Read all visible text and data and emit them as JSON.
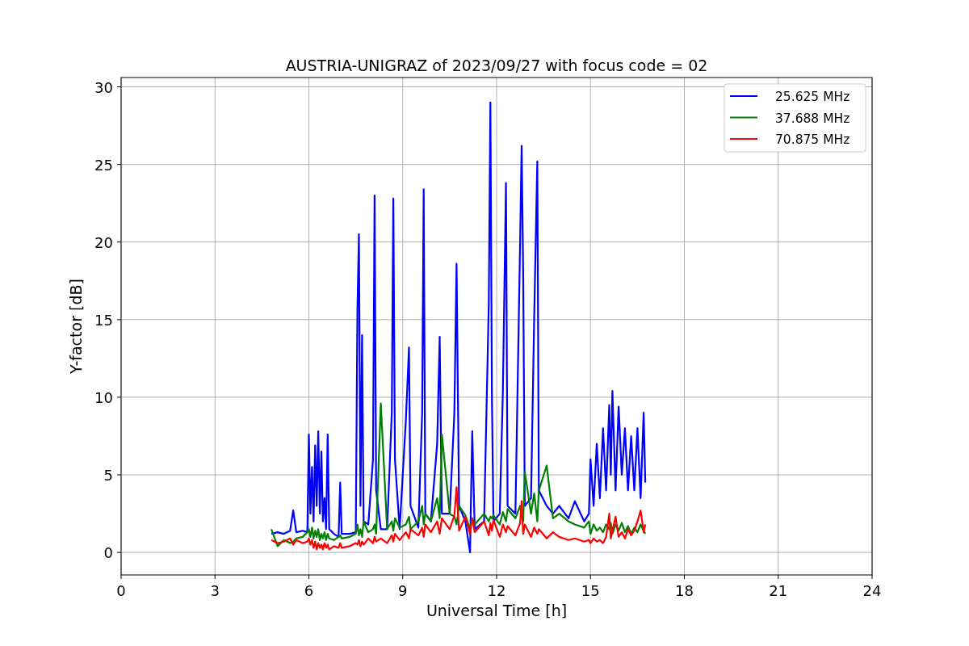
{
  "chart_data": {
    "type": "line",
    "title": "AUSTRIA-UNIGRAZ of 2023/09/27 with focus code = 02",
    "xlabel": "Universal Time [h]",
    "ylabel": "Y-factor [dB]",
    "xlim": [
      0,
      24
    ],
    "ylim": [
      -1.45,
      30.6
    ],
    "grid": true,
    "legend": "upper right",
    "xticks": [
      0,
      3,
      6,
      9,
      12,
      15,
      18,
      21,
      24
    ],
    "yticks": [
      0,
      5,
      10,
      15,
      20,
      25,
      30
    ],
    "x": [
      4.8,
      5.0,
      5.2,
      5.4,
      5.5,
      5.6,
      5.8,
      5.95,
      6.0,
      6.05,
      6.1,
      6.15,
      6.2,
      6.25,
      6.3,
      6.35,
      6.4,
      6.45,
      6.5,
      6.55,
      6.6,
      6.65,
      6.8,
      6.95,
      7.0,
      7.05,
      7.3,
      7.5,
      7.55,
      7.6,
      7.65,
      7.7,
      7.75,
      7.9,
      8.05,
      8.1,
      8.15,
      8.3,
      8.5,
      8.65,
      8.7,
      8.75,
      8.9,
      9.1,
      9.2,
      9.25,
      9.5,
      9.62,
      9.67,
      9.72,
      9.9,
      10.1,
      10.18,
      10.25,
      10.5,
      10.65,
      10.72,
      10.8,
      11.0,
      11.15,
      11.22,
      11.3,
      11.6,
      11.75,
      11.8,
      11.85,
      11.9,
      12.1,
      12.2,
      12.3,
      12.35,
      12.6,
      12.75,
      12.8,
      12.85,
      12.9,
      13.1,
      13.2,
      13.3,
      13.35,
      13.6,
      13.8,
      14.0,
      14.3,
      14.5,
      14.8,
      14.95,
      15.0,
      15.1,
      15.2,
      15.3,
      15.4,
      15.5,
      15.6,
      15.65,
      15.7,
      15.8,
      15.9,
      16.0,
      16.1,
      16.2,
      16.3,
      16.4,
      16.5,
      16.6,
      16.7,
      16.75
    ],
    "series": [
      {
        "name": "25.625 MHz",
        "color": "#0000ff",
        "values": [
          1.2,
          1.3,
          1.2,
          1.4,
          2.7,
          1.3,
          1.4,
          1.3,
          7.6,
          2.5,
          5.5,
          2.0,
          6.9,
          3.0,
          7.8,
          2.5,
          6.5,
          2.0,
          3.5,
          1.5,
          7.6,
          1.5,
          1.2,
          1.0,
          4.5,
          1.2,
          1.2,
          1.3,
          15.5,
          20.5,
          3,
          14,
          2,
          1.8,
          6,
          23,
          4,
          1.5,
          1.5,
          9,
          22.8,
          6,
          1.5,
          8.5,
          13.2,
          3,
          1.6,
          9,
          23.4,
          2.5,
          2,
          7,
          13.9,
          2.5,
          2.5,
          9,
          18.6,
          3,
          2,
          0,
          7.8,
          1.5,
          2,
          16,
          29,
          10,
          2,
          2.5,
          10.5,
          23.8,
          3,
          2.5,
          20,
          26.2,
          18,
          3,
          3.5,
          15,
          25.2,
          4,
          3,
          2.5,
          3,
          2.2,
          3.3,
          2,
          2.5,
          6,
          3,
          7,
          3.5,
          8,
          4,
          9.5,
          5,
          10.4,
          4,
          9.4,
          5,
          8,
          4,
          7.5,
          4,
          8,
          3.5,
          9,
          4.5
        ]
      },
      {
        "name": "37.688 MHz",
        "color": "#008000",
        "values": [
          1.5,
          0.4,
          0.8,
          0.6,
          0.7,
          0.9,
          1.0,
          1.3,
          1.5,
          1.0,
          1.6,
          0.9,
          1.4,
          1.0,
          1.5,
          0.8,
          1.2,
          0.9,
          1.3,
          0.8,
          1.2,
          0.9,
          0.8,
          1.0,
          1.1,
          0.9,
          1.0,
          1.2,
          1.8,
          1.1,
          1.5,
          1.0,
          2.0,
          1.3,
          1.5,
          1.8,
          1.2,
          9.6,
          1.5,
          2.0,
          1.4,
          2.2,
          1.6,
          1.8,
          2.3,
          1.5,
          2.0,
          3.0,
          1.8,
          2.5,
          2.0,
          3.5,
          2.2,
          7.6,
          2.5,
          2.3,
          1.8,
          3.0,
          2.4,
          1.5,
          2.2,
          1.8,
          2.5,
          2.0,
          2.3,
          2.2,
          2.4,
          1.8,
          2.6,
          2.0,
          2.8,
          2.2,
          3.0,
          2.4,
          2.0,
          5.2,
          2.5,
          3.8,
          2.0,
          4.0,
          5.6,
          2.2,
          2.5,
          2.0,
          1.8,
          1.6,
          2.0,
          1.2,
          1.8,
          1.4,
          1.6,
          1.3,
          1.8,
          1.5,
          1.9,
          1.2,
          1.8,
          1.4,
          1.9,
          1.3,
          1.7,
          1.2,
          1.6,
          1.3,
          1.8,
          1.4,
          1.2
        ]
      },
      {
        "name": "70.875 MHz",
        "color": "#ff0000",
        "values": [
          0.8,
          0.6,
          0.7,
          0.9,
          0.5,
          0.8,
          0.6,
          0.7,
          0.9,
          0.5,
          0.8,
          0.3,
          0.7,
          0.2,
          0.6,
          0.3,
          0.5,
          0.2,
          0.6,
          0.3,
          0.5,
          0.2,
          0.4,
          0.3,
          0.6,
          0.3,
          0.4,
          0.6,
          0.5,
          0.8,
          0.4,
          0.7,
          0.5,
          0.9,
          0.6,
          1.0,
          0.7,
          0.9,
          0.6,
          1.1,
          0.7,
          1.2,
          0.8,
          1.3,
          0.9,
          1.5,
          1.1,
          1.6,
          1.0,
          1.8,
          1.3,
          2.0,
          1.2,
          2.2,
          1.5,
          2.4,
          4.2,
          1.4,
          2.3,
          1.2,
          2.2,
          1.3,
          2.0,
          1.1,
          1.9,
          1.4,
          2.1,
          1.0,
          1.8,
          1.3,
          1.7,
          1.1,
          1.9,
          3.3,
          1.2,
          1.8,
          1.0,
          1.6,
          1.2,
          1.5,
          0.9,
          1.3,
          1.0,
          0.8,
          0.9,
          0.7,
          0.8,
          0.6,
          0.9,
          0.7,
          0.8,
          0.6,
          1.0,
          2.5,
          0.9,
          1.4,
          2.3,
          1.0,
          1.3,
          0.9,
          1.5,
          1.1,
          1.4,
          2.0,
          2.7,
          1.3,
          1.8
        ]
      }
    ]
  }
}
